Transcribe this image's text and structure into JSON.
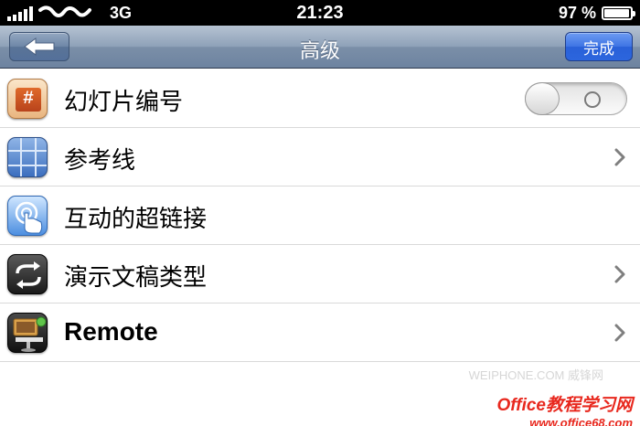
{
  "status_bar": {
    "network": "3G",
    "time": "21:23",
    "battery_percent": "97 %",
    "battery_level": 0.97
  },
  "nav": {
    "title": "高级",
    "done_label": "完成"
  },
  "rows": [
    {
      "label": "幻灯片编号",
      "icon": "slide-number-icon",
      "accessory": "toggle",
      "toggle_on": false
    },
    {
      "label": "参考线",
      "icon": "guides-icon",
      "accessory": "chevron"
    },
    {
      "label": "互动的超链接",
      "icon": "hyperlink-touch-icon",
      "accessory": "none"
    },
    {
      "label": "演示文稿类型",
      "icon": "presentation-type-icon",
      "accessory": "chevron"
    },
    {
      "label": "Remote",
      "icon": "remote-icon",
      "accessory": "chevron"
    }
  ],
  "watermarks": {
    "weiphone": "WEIPHONE.COM 威锋网",
    "office_title": "Office教程学习网",
    "office_url": "www.office68.com"
  }
}
